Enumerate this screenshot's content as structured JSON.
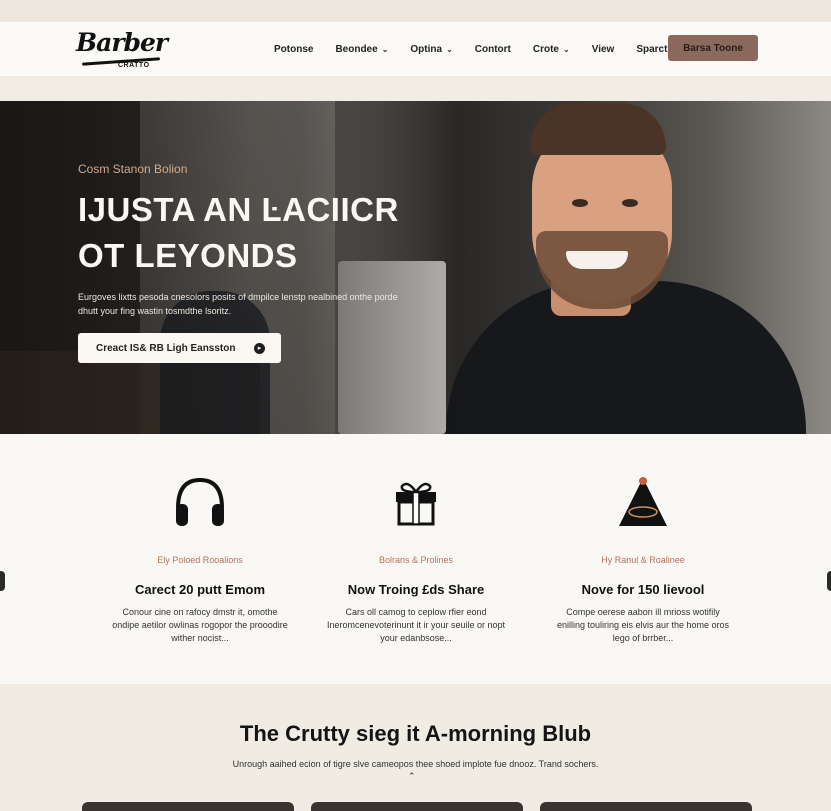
{
  "brand": {
    "logo_main": "Barber",
    "logo_sub": "CRATTO"
  },
  "nav": {
    "items": [
      {
        "label": "Potonse",
        "dropdown": false
      },
      {
        "label": "Beondee",
        "dropdown": true
      },
      {
        "label": "Optina",
        "dropdown": true
      },
      {
        "label": "Contort",
        "dropdown": false
      },
      {
        "label": "Crote",
        "dropdown": true
      },
      {
        "label": "View",
        "dropdown": false
      },
      {
        "label": "Sparct",
        "dropdown": false
      }
    ],
    "cta": "Barsa Toone",
    "cta_color": "#8b6a5d"
  },
  "hero": {
    "eyebrow": "Cosm Stanon Bolion",
    "title_line1": "IJUSTA AN ĿACIICR",
    "title_line2": "OT LEYONDS",
    "description": "Eurgoves lixtts pesoda cnesolors posits of dmpilce lenstp nealbined onthe porde dhutt your fing wastin tosmdthe lsoritz.",
    "button_label": "Creact IS& RB Ligh Eansston",
    "button_icon": "arrow-right-circle-icon"
  },
  "features": [
    {
      "icon": "headphones-icon",
      "tag": "Ely Poloed Rooalions",
      "title": "Carect 20 putt Emom",
      "description": "Conour cine on rafocy dmstr it, omothe ondipe aetilor owlinas rogopor the prooodire wither nocist..."
    },
    {
      "icon": "gift-icon",
      "tag": "Bolrans & Prolines",
      "title": "Now Troing £ds Share",
      "description": "Cars oll camog to ceplow rfier eond Ineromcenevoterinunt it ir your seuile or nopt your edanbsose..."
    },
    {
      "icon": "cone-icon",
      "tag": "Hy Ranul & Roalinee",
      "title": "Nove for 150 lievool",
      "description": "Compe oerese aabon ill mrioss wotifily enilling touliring eis elvis aur the home oros lego of brrber..."
    }
  ],
  "blog": {
    "title": "The Crutty sieg it A-morning Blub",
    "subtitle": "Unrough aaihed ecion of tigre slve cameopos thee shoed implote fue dnooz. Trand sochers."
  },
  "colors": {
    "accent": "#8b6a5d",
    "tag": "#b0735a",
    "hero_eyebrow": "#d6a88f"
  }
}
